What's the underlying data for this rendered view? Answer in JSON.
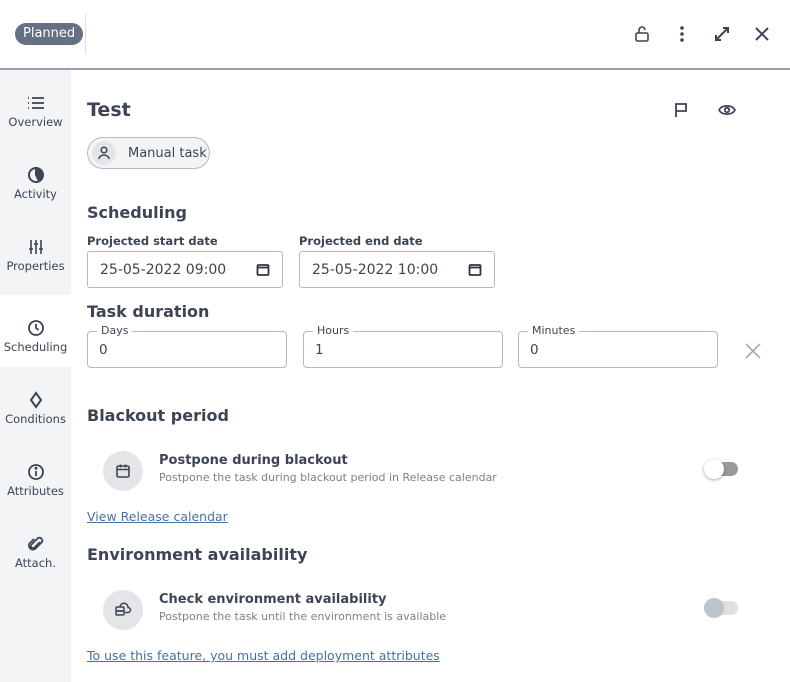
{
  "header": {
    "status": "Planned",
    "icons": [
      "lock-open-icon",
      "more-vertical-icon",
      "expand-icon",
      "close-icon"
    ]
  },
  "sidebar": {
    "active": "Scheduling",
    "items": [
      {
        "label": "Overview",
        "icon": "list-icon"
      },
      {
        "label": "Activity",
        "icon": "activity-icon"
      },
      {
        "label": "Properties",
        "icon": "sliders-icon"
      },
      {
        "label": "Scheduling",
        "icon": "clock-icon"
      },
      {
        "label": "Conditions",
        "icon": "diamond-icon"
      },
      {
        "label": "Attributes",
        "icon": "info-icon"
      },
      {
        "label": "Attach.",
        "icon": "paperclip-icon"
      }
    ]
  },
  "task": {
    "title": "Test",
    "type_chip": "Manual task",
    "actions": [
      "flag-icon",
      "watch-eye-icon"
    ]
  },
  "scheduling": {
    "section_title": "Scheduling",
    "start_label": "Projected start date",
    "start_value": "25-05-2022 09:00",
    "end_label": "Projected end date",
    "end_value": "25-05-2022 10:00"
  },
  "duration": {
    "section_title": "Task duration",
    "days_label": "Days",
    "days_value": "0",
    "hours_label": "Hours",
    "hours_value": "1",
    "minutes_label": "Minutes",
    "minutes_value": "0"
  },
  "blackout": {
    "section_title": "Blackout period",
    "option_title": "Postpone during blackout",
    "option_subtitle": "Postpone the task during blackout period in Release calendar",
    "toggle_on": false,
    "link": "View Release calendar"
  },
  "environment": {
    "section_title": "Environment availability",
    "option_title": "Check environment availability",
    "option_subtitle": "Postpone the task until the environment is available",
    "toggle_on": false,
    "toggle_disabled": true,
    "link": "To use this feature, you must add deployment attributes"
  },
  "colors": {
    "status_pill": "#667085",
    "text": "#3d4453",
    "link": "#4a6fa5",
    "sidebar_bg": "#f3f4f6"
  }
}
